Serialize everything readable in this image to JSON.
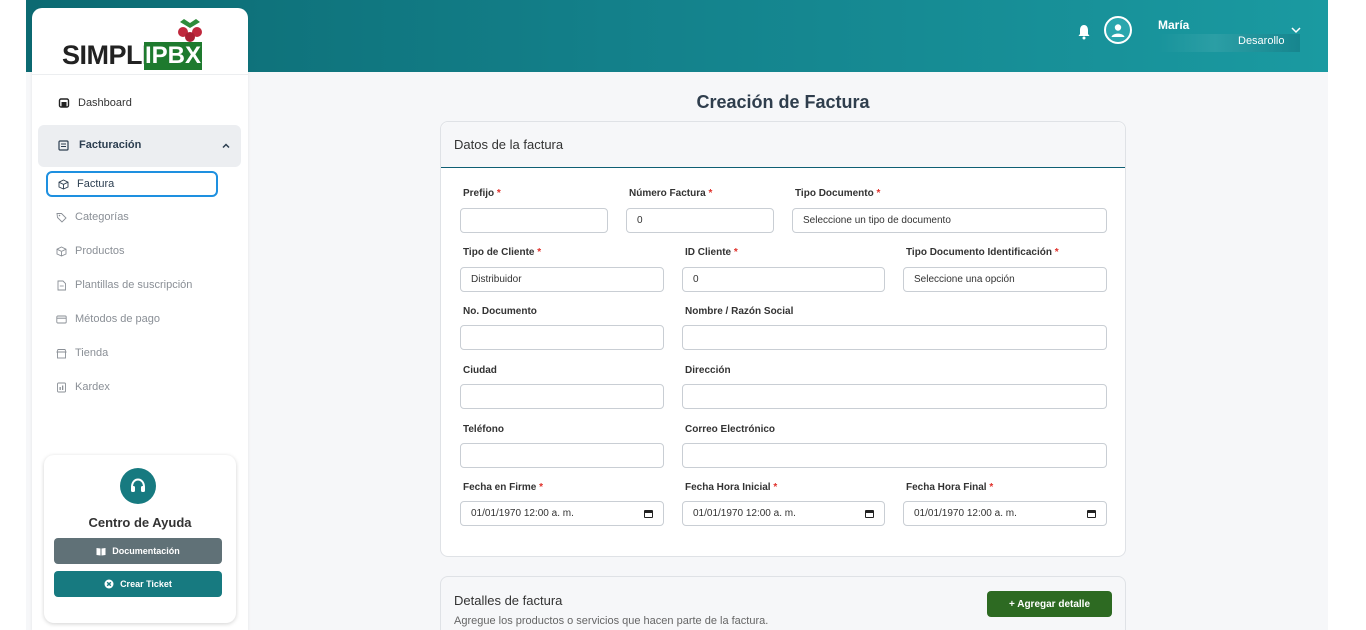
{
  "logo": {
    "text_left": "SIMPLE",
    "text_box": "IPBX"
  },
  "header": {
    "user_name": "María",
    "user_role": "Desarollo"
  },
  "sidebar": {
    "dashboard": "Dashboard",
    "group_label": "Facturación",
    "items": [
      {
        "label": "Factura",
        "icon": "box-icon"
      },
      {
        "label": "Categorías",
        "icon": "tag-icon"
      },
      {
        "label": "Productos",
        "icon": "box-icon"
      },
      {
        "label": "Plantillas de suscripción",
        "icon": "document-icon"
      },
      {
        "label": "Métodos de pago",
        "icon": "card-icon"
      },
      {
        "label": "Tienda",
        "icon": "store-icon"
      },
      {
        "label": "Kardex",
        "icon": "ledger-icon"
      }
    ],
    "help": {
      "title": "Centro de Ayuda",
      "doc_button": "Documentación",
      "ticket_button": "Crear Ticket"
    }
  },
  "page": {
    "title": "Creación de Factura"
  },
  "invoice_card": {
    "header": "Datos de la factura",
    "fields": {
      "prefijo": {
        "label": "Prefijo",
        "value": ""
      },
      "numero_factura": {
        "label": "Número Factura",
        "value": "0"
      },
      "tipo_documento": {
        "label": "Tipo Documento",
        "value": "Seleccione un tipo de documento"
      },
      "tipo_cliente": {
        "label": "Tipo de Cliente",
        "value": "Distribuidor"
      },
      "id_cliente": {
        "label": "ID Cliente",
        "value": "0"
      },
      "tipo_doc_identificacion": {
        "label": "Tipo Documento Identificación",
        "value": "Seleccione una opción"
      },
      "no_documento": {
        "label": "No. Documento",
        "value": ""
      },
      "nombre_razon": {
        "label": "Nombre / Razón Social",
        "value": ""
      },
      "ciudad": {
        "label": "Ciudad",
        "value": ""
      },
      "direccion": {
        "label": "Dirección",
        "value": ""
      },
      "telefono": {
        "label": "Teléfono",
        "value": ""
      },
      "correo": {
        "label": "Correo Electrónico",
        "value": ""
      },
      "fecha_firme": {
        "label": "Fecha en Firme",
        "value": "01/01/1970 12:00 a. m."
      },
      "fecha_inicial": {
        "label": "Fecha Hora Inicial",
        "value": "01/01/1970 12:00 a. m."
      },
      "fecha_final": {
        "label": "Fecha Hora Final",
        "value": "01/01/1970 12:00 a. m."
      }
    },
    "required_mark": "*"
  },
  "details_card": {
    "title": "Detalles de factura",
    "subtitle": "Agregue los productos o servicios que hacen parte de la factura.",
    "add_button": "+ Agregar detalle"
  },
  "colors": {
    "primary": "#177a80",
    "accent_button": "#2d6a22",
    "required": "#e0312b",
    "active_outline": "#1e90e0"
  }
}
